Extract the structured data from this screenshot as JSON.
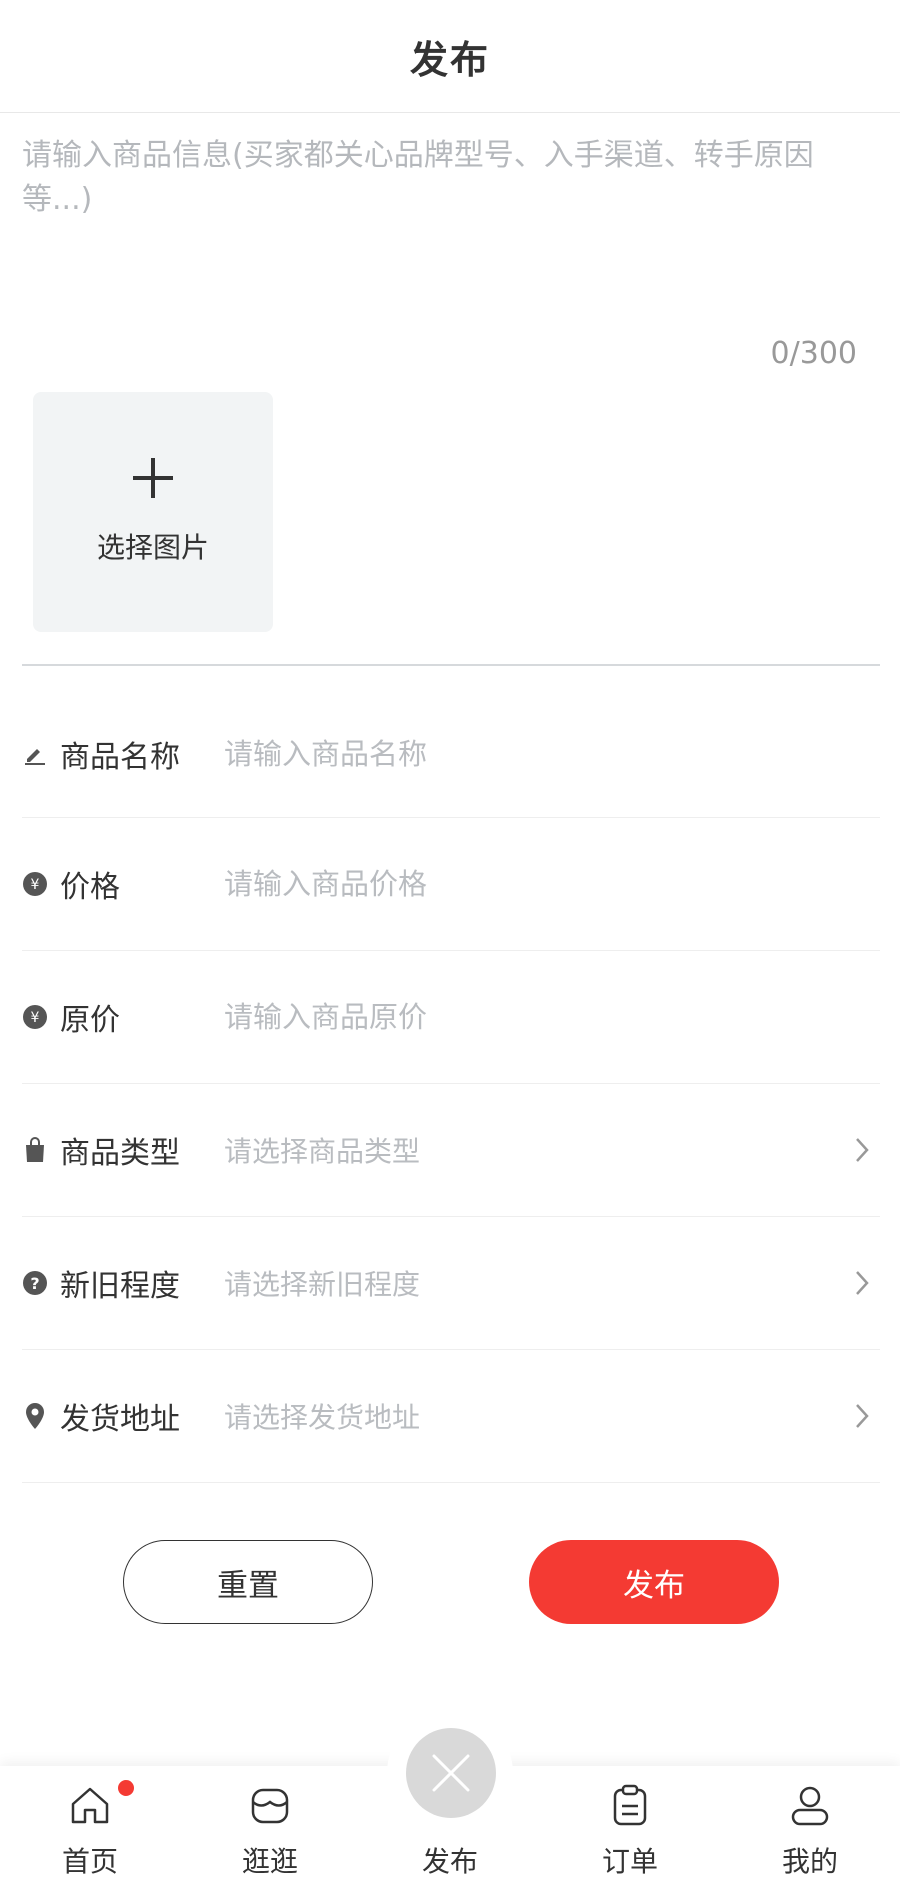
{
  "header": {
    "title": "发布"
  },
  "description": {
    "placeholder": "请输入商品信息(买家都关心品牌型号、入手渠道、转手原因等...)",
    "counter": "0/300"
  },
  "upload": {
    "label": "选择图片",
    "icon": "plus-icon"
  },
  "form": {
    "fields": [
      {
        "label": "商品名称",
        "placeholder": "请输入商品名称",
        "icon": "pencil-icon"
      },
      {
        "label": "价格",
        "placeholder": "请输入商品价格",
        "icon": "yen-icon"
      },
      {
        "label": "原价",
        "placeholder": "请输入商品原价",
        "icon": "yen-icon"
      },
      {
        "label": "商品类型",
        "placeholder": "请选择商品类型",
        "icon": "bag-icon"
      },
      {
        "label": "新旧程度",
        "placeholder": "请选择新旧程度",
        "icon": "question-icon"
      },
      {
        "label": "发货地址",
        "placeholder": "请选择发货地址",
        "icon": "location-pin-icon"
      }
    ]
  },
  "actions": {
    "reset": "重置",
    "publish": "发布"
  },
  "tabbar": {
    "items": [
      {
        "label": "首页",
        "icon": "home-icon",
        "badge": true
      },
      {
        "label": "逛逛",
        "icon": "shop-icon"
      },
      {
        "label": "发布",
        "icon": "close-icon"
      },
      {
        "label": "订单",
        "icon": "clipboard-icon"
      },
      {
        "label": "我的",
        "icon": "user-icon"
      }
    ]
  },
  "colors": {
    "accent": "#f43a33",
    "placeholder": "#b9bcc0",
    "text": "#333333",
    "upload_bg": "#f2f4f5"
  }
}
